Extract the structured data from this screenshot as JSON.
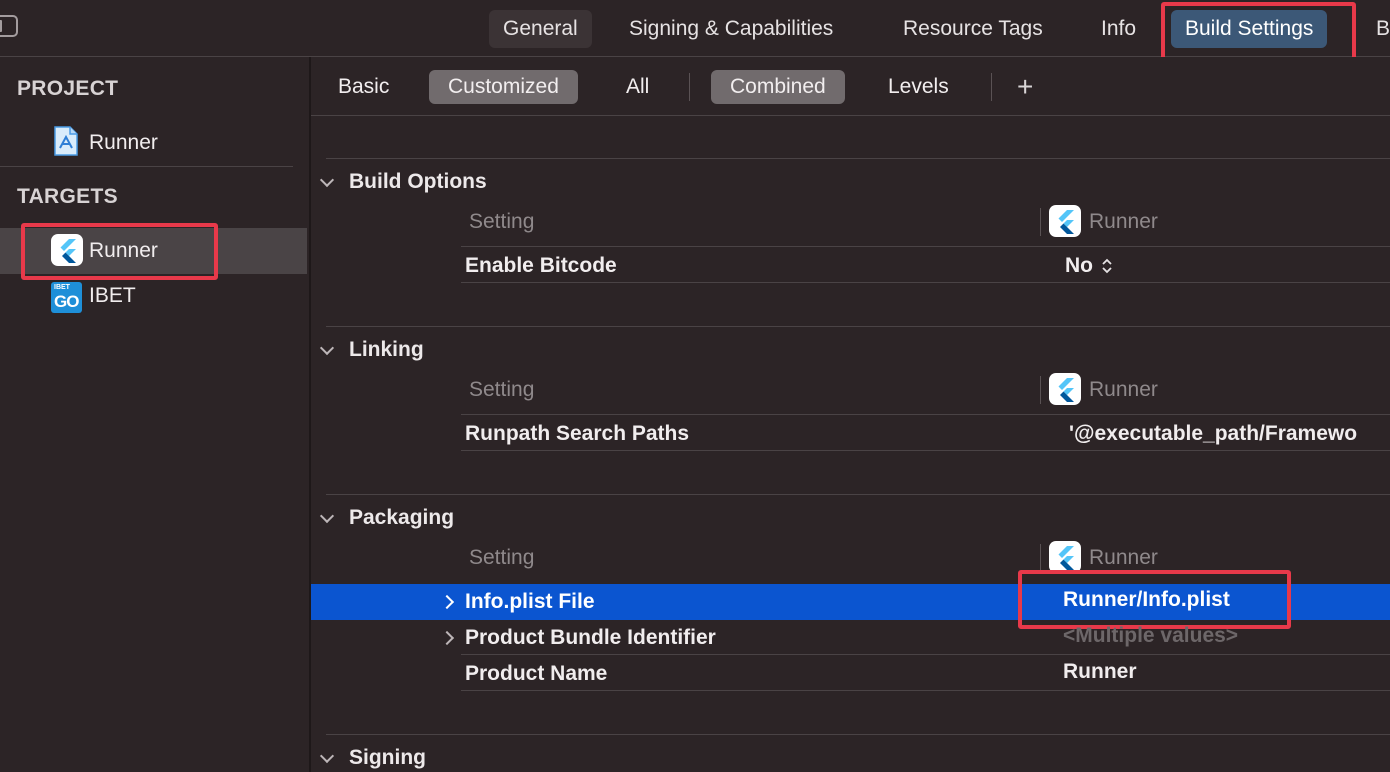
{
  "top_tabs": {
    "general": "General",
    "signing": "Signing & Capabilities",
    "resource_tags": "Resource Tags",
    "info": "Info",
    "build_settings": "Build Settings",
    "cut_off": "B"
  },
  "sidebar": {
    "project_header": "PROJECT",
    "project_item": "Runner",
    "targets_header": "TARGETS",
    "targets": [
      "Runner",
      "IBET"
    ],
    "ibet_icon_text_top": "IBET",
    "ibet_icon_text_bottom": "GO"
  },
  "filters": {
    "basic": "Basic",
    "customized": "Customized",
    "all": "All",
    "combined": "Combined",
    "levels": "Levels",
    "add": "+"
  },
  "groups": [
    {
      "title": "Build Options",
      "setting_header": "Setting",
      "target_header": "Runner",
      "rows": [
        {
          "label": "Enable Bitcode",
          "value": "No"
        }
      ]
    },
    {
      "title": "Linking",
      "setting_header": "Setting",
      "target_header": "Runner",
      "rows": [
        {
          "label": "Runpath Search Paths",
          "value": "'@executable_path/Framewo"
        }
      ]
    },
    {
      "title": "Packaging",
      "setting_header": "Setting",
      "target_header": "Runner",
      "rows": [
        {
          "label": "Info.plist File",
          "value": "Runner/Info.plist"
        },
        {
          "label": "Product Bundle Identifier",
          "value": "<Multiple values>"
        },
        {
          "label": "Product Name",
          "value": "Runner"
        }
      ]
    },
    {
      "title": "Signing"
    }
  ],
  "colors": {
    "background": "#2c2426",
    "active_tab": "#3c5877",
    "selected_row": "#0b55d0",
    "highlight": "#e8394a"
  }
}
